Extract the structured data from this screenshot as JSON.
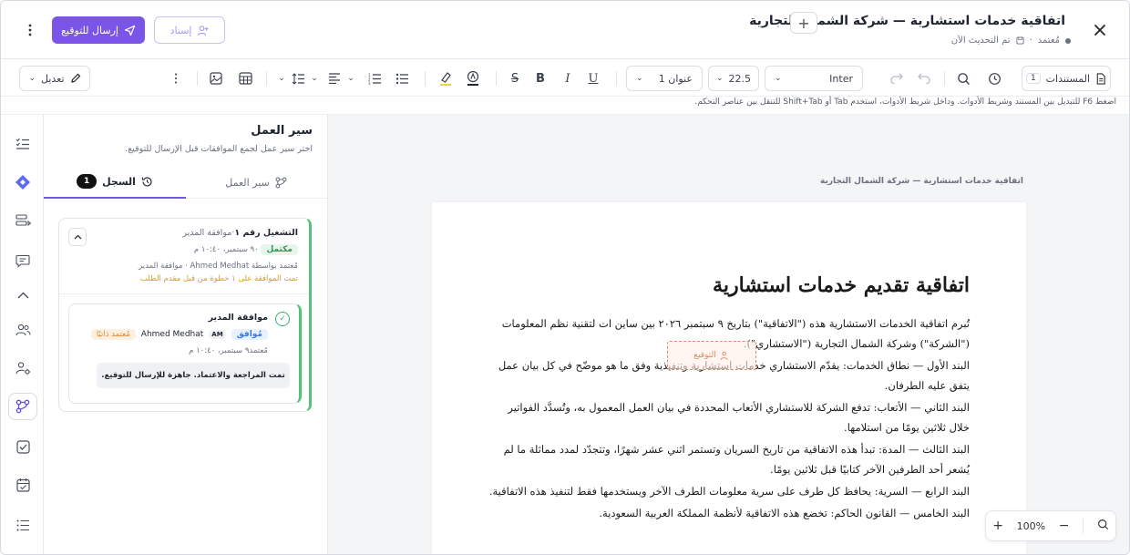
{
  "header": {
    "title": "اتفاقية خدمات استشارية — شركة الشمال التجارية",
    "status": "مُعتمد",
    "updated": "تم التحديث الآن",
    "send_label": "إرسال للتوقيع",
    "assign_label": "إسناد"
  },
  "toolbar": {
    "documents_label": "المستندات",
    "documents_count": "1",
    "font_name": "Inter",
    "font_size": "22.5",
    "heading_style": "عنوان 1",
    "edit_label": "تعديل"
  },
  "hint": "اضغط F6 للتبديل بين المستند وشريط الأدوات. وداخل شريط الأدوات، استخدم Tab أو Shift+Tab للتنقل بين عناصر التحكم.",
  "canvas": {
    "breadcrumb": "اتفاقية خدمات استشارية — شركة الشمال التجارية",
    "signature_label": "التوقيع",
    "zoom": "100%"
  },
  "document": {
    "title": "اتفاقية تقديم خدمات استشارية",
    "paragraphs": [
      "تُبرم اتفاقية الخدمات الاستشارية هذه (\"الاتفاقية\") بتاريخ ٩ سبتمبر ٢٠٢٦ بين ساين ات لتقنية نظم المعلومات (\"الشركة\") وشركة الشمال التجارية (\"الاستشاري\").",
      "البند الأول — نطاق الخدمات: يقدّم الاستشاري خدمات استشارية وتنفيذية وفق ما هو موضّح في كل بيان عمل يتفق عليه الطرفان.",
      "البند الثاني — الأتعاب: تدفع الشركة للاستشاري الأتعاب المحددة في بيان العمل المعمول به، وتُسدَّد الفواتير خلال ثلاثين يومًا من استلامها.",
      "البند الثالث — المدة: تبدأ هذه الاتفاقية من تاريخ السريان وتستمر اثني عشر شهرًا، وتتجدّد لمدد مماثلة ما لم يُشعر أحد الطرفين الآخر كتابيًا قبل ثلاثين يومًا.",
      "البند الرابع — السرية: يحافظ كل طرف على سرية معلومات الطرف الآخر ويستخدمها فقط لتنفيذ هذه الاتفاقية.",
      "البند الخامس — القانون الحاكم: تخضع هذه الاتفاقية لأنظمة المملكة العربية السعودية."
    ]
  },
  "panel": {
    "title": "سير العمل",
    "subtitle": "اختر سير عمل لجمع الموافقات قبل الإرسال للتوقيع.",
    "tab_workflow": "سير العمل",
    "tab_history": "السجل",
    "history_count": "1",
    "run": {
      "title": "التشغيل رقم ١",
      "subtitle": "·موافقة المدير",
      "status": "مكتمل",
      "date": "٩٠ سبتمبر، ١٠:٤٠ م",
      "approved_by": "مُعتمد بواسطة Ahmed Medhat · موافقة المدير",
      "note": "تمت الموافقة على ١ خطوة من قبل مقدم الطلب"
    },
    "step": {
      "title": "موافقة المدير",
      "decision": "مُوافق",
      "user_initials": "AM",
      "user_name": "Ahmed Medhat",
      "auto_badge": "مُعتمد ذاتيًا",
      "date": "مُعتمد٩ سبتمبر، ١٠:٤٠ م",
      "note": "تمت المراجعة والاعتماد. جاهزة للإرسال للتوقيع."
    }
  },
  "colors": {
    "accent": "#7b55e8",
    "success": "#3ab26a",
    "warning": "#e08a2a"
  }
}
